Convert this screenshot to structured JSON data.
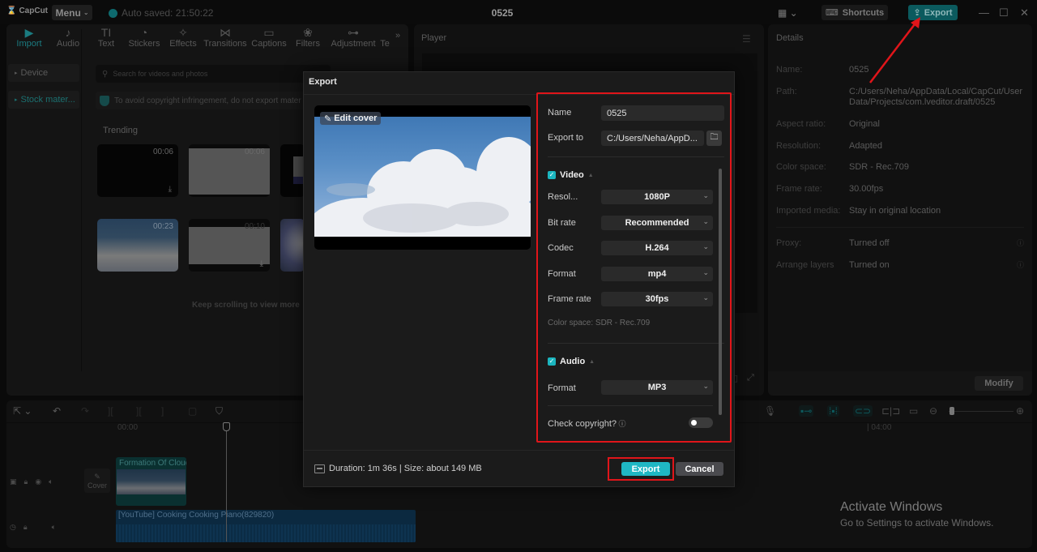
{
  "titlebar": {
    "app_name": "CapCut",
    "menu_label": "Menu",
    "autosave_text": "Auto saved: 21:50:22",
    "project_title": "0525",
    "shortcuts_label": "Shortcuts",
    "export_label": "Export"
  },
  "toolbar": {
    "tabs": [
      {
        "label": "Import",
        "icon": "import-icon",
        "glyph": "▶",
        "active": true
      },
      {
        "label": "Audio",
        "icon": "audio-icon",
        "glyph": "♪"
      },
      {
        "label": "Text",
        "icon": "text-icon",
        "glyph": "TI"
      },
      {
        "label": "Stickers",
        "icon": "stickers-icon",
        "glyph": "◔"
      },
      {
        "label": "Effects",
        "icon": "effects-icon",
        "glyph": "✧"
      },
      {
        "label": "Transitions",
        "icon": "transitions-icon",
        "glyph": "⋈"
      },
      {
        "label": "Captions",
        "icon": "captions-icon",
        "glyph": "▭"
      },
      {
        "label": "Filters",
        "icon": "filters-icon",
        "glyph": "❀"
      },
      {
        "label": "Adjustment",
        "icon": "adjustment-icon",
        "glyph": "⊶"
      },
      {
        "label": "Te",
        "icon": "",
        "glyph": ""
      }
    ],
    "more_glyph": "»"
  },
  "left_nav": {
    "items": [
      {
        "label": "Device"
      },
      {
        "label": "Stock mater...",
        "active": true
      }
    ]
  },
  "media": {
    "search_placeholder": "Search for videos and photos",
    "copyright_notice": "To avoid copyright infringement, do not export mater",
    "section_title": "Trending",
    "thumbs": [
      {
        "duration": "00:06"
      },
      {
        "duration": "00:06"
      },
      {
        "duration": ""
      },
      {
        "duration": "00:23"
      },
      {
        "duration": "00:10"
      },
      {
        "duration": ""
      }
    ],
    "keep_scrolling": "Keep scrolling to view more"
  },
  "player": {
    "title": "Player"
  },
  "details": {
    "title": "Details",
    "rows": [
      {
        "label": "Name:",
        "value": "0525"
      },
      {
        "label": "Path:",
        "value": "C:/Users/Neha/AppData/Local/CapCut/User Data/Projects/com.lveditor.draft/0525"
      },
      {
        "label": "Aspect ratio:",
        "value": "Original"
      },
      {
        "label": "Resolution:",
        "value": "Adapted"
      },
      {
        "label": "Color space:",
        "value": "SDR - Rec.709"
      },
      {
        "label": "Frame rate:",
        "value": "30.00fps"
      },
      {
        "label": "Imported media:",
        "value": "Stay in original location"
      },
      {
        "label": "Proxy:",
        "value": "Turned off"
      },
      {
        "label": "Arrange layers",
        "value": "Turned on"
      }
    ],
    "modify_label": "Modify"
  },
  "timeline": {
    "ruler_start": "00:00",
    "ruler_mark": "| 04:00",
    "cover_label": "Cover",
    "video_clip_name": "Formation Of Clouds",
    "audio_clip_name": "[YouTube] Cooking Cooking Piano(829820)"
  },
  "export_dialog": {
    "title": "Export",
    "edit_cover_label": "Edit cover",
    "name_label": "Name",
    "name_value": "0525",
    "export_to_label": "Export to",
    "export_to_value": "C:/Users/Neha/AppD...",
    "video_section": {
      "label": "Video",
      "checked": true,
      "fields": [
        {
          "label": "Resol...",
          "value": "1080P"
        },
        {
          "label": "Bit rate",
          "value": "Recommended"
        },
        {
          "label": "Codec",
          "value": "H.264"
        },
        {
          "label": "Format",
          "value": "mp4"
        },
        {
          "label": "Frame rate",
          "value": "30fps"
        }
      ],
      "color_space": "Color space: SDR - Rec.709"
    },
    "audio_section": {
      "label": "Audio",
      "checked": true,
      "fields": [
        {
          "label": "Format",
          "value": "MP3"
        }
      ]
    },
    "check_copyright_label": "Check copyright?",
    "check_copyright_enabled": false,
    "footer_info": "Duration: 1m 36s | Size: about 149 MB",
    "export_label": "Export",
    "cancel_label": "Cancel"
  },
  "os_watermark": {
    "line1": "Activate Windows",
    "line2": "Go to Settings to activate Windows."
  },
  "colors": {
    "accent": "#1fb7c3",
    "highlight_red": "#e0151a"
  }
}
